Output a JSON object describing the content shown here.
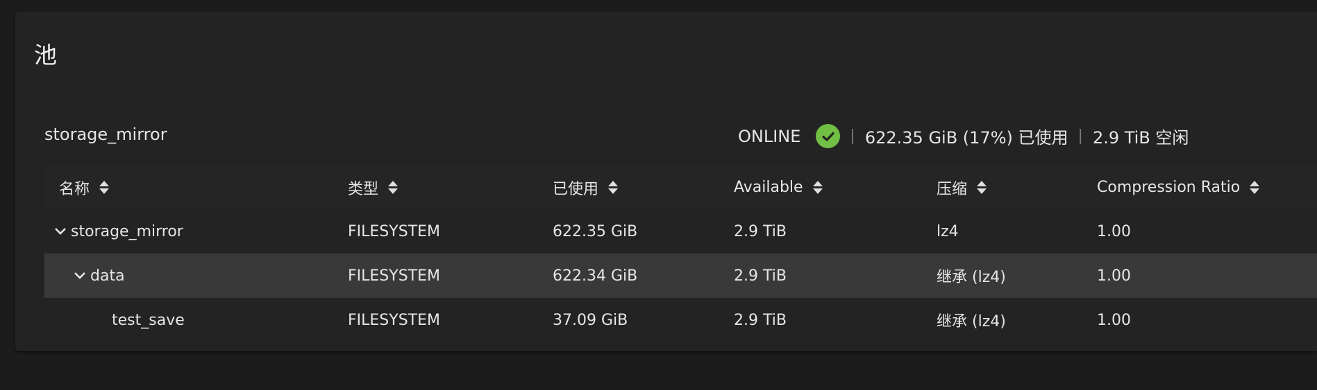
{
  "card": {
    "title": "池"
  },
  "pool": {
    "name": "storage_mirror",
    "status": "ONLINE",
    "status_icon": "check-circle-icon",
    "used": "622.35 GiB (17%) 已使用",
    "free": "2.9 TiB 空闲",
    "separator": "|",
    "colors": {
      "status_ok": "#71bf44"
    }
  },
  "table": {
    "columns": [
      "名称",
      "类型",
      "已使用",
      "Available",
      "压缩",
      "Compression Ratio"
    ],
    "rows": [
      {
        "name": "storage_mirror",
        "expanded": true,
        "type": "FILESYSTEM",
        "used": "622.35 GiB",
        "available": "2.9 TiB",
        "compression": "lz4",
        "ratio": "1.00"
      },
      {
        "name": "data",
        "expanded": true,
        "type": "FILESYSTEM",
        "used": "622.34 GiB",
        "available": "2.9 TiB",
        "compression": "继承 (lz4)",
        "ratio": "1.00",
        "selected": true
      },
      {
        "name": "test_save",
        "type": "FILESYSTEM",
        "used": "37.09 GiB",
        "available": "2.9 TiB",
        "compression": "继承 (lz4)",
        "ratio": "1.00"
      }
    ]
  }
}
